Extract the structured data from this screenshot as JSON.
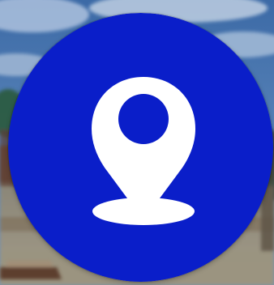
{
  "scene": {
    "background_description_icon": "blurred-waterfront-photo",
    "sky_color": "#4c7bb3",
    "cloud_color": "#a9bfd8",
    "water_color": "#8e8a7d",
    "shore_color": "#6b4b3a",
    "tree_color": "#2e5b3f"
  },
  "badge": {
    "icon": "location-pin-icon",
    "fill_color": "#0a1ec9",
    "icon_color": "#ffffff"
  }
}
